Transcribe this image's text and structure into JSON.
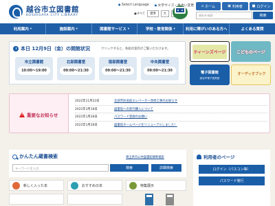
{
  "header": {
    "logo_title": "越谷市立図書館",
    "logo_sub": "KOSHIGAYA CITY LIBRARY",
    "links": [
      "Select Language",
      "文字サイズ・色合い変更",
      "ふりがな"
    ],
    "size_label": "●すべて",
    "size_options": [
      "標準",
      "大",
      "最大"
    ],
    "home_label": "ホーム",
    "myaccount_label": "利用者",
    "login_label": "ログイン",
    "search_placeholder": "資料を検索",
    "search_button": "検索"
  },
  "nav": [
    "利用案内",
    "施設案内",
    "図書館サービス",
    "学校・教育関係",
    "利用に障がいのある方へ",
    "よくある質問"
  ],
  "status": {
    "title": "本日 12月9日（金）の開館状況",
    "note": "クリックすると、各館の案内がご覧いただけます。",
    "branches": [
      {
        "name": "市立図書館",
        "hours": "10:00～19:00"
      },
      {
        "name": "北部図書室",
        "hours": "09:00～21:30"
      },
      {
        "name": "南部図書室",
        "hours": "09:00～21:30"
      },
      {
        "name": "中央図書室",
        "hours": "09:00～21:30"
      }
    ]
  },
  "banners": {
    "teens": "ティーンズページ",
    "kodomo": "こどものページ",
    "ebook": "電子図書館",
    "ebook_sub": "越谷市電子図書館",
    "audio": "オーディオブック"
  },
  "notice": {
    "title": "重要なお知らせ",
    "items": [
      {
        "date": "2022年11月22日",
        "text": "北部市民会館エレベーター改修工事のお知らせ"
      },
      {
        "date": "2022年3月18日",
        "text": "図書館への新刊購入について"
      },
      {
        "date": "2022年1月28日",
        "text": "パスワード登録のお願い"
      },
      {
        "date": "2022年1月28日",
        "text": "図書館ホームページをリニューアルしました！"
      }
    ]
  },
  "kensaku": {
    "title": "かんたん蔵書検索",
    "link": "埼玉県内公共図書館横断検索",
    "placeholder": "キーワードを入力",
    "button": "検索",
    "detail_button": "詳細検索"
  },
  "userpage": {
    "title": "利用者のページ",
    "login_button": "ログイン（パスコン等）",
    "password_button": "パスワード発行"
  },
  "tiles": [
    "新しく入った本",
    "おすすめの本",
    "特集展示"
  ],
  "colors": {
    "brand_blue": "#1f5fa8",
    "notice_red": "#c4305a",
    "background": "#f4f1ea"
  }
}
